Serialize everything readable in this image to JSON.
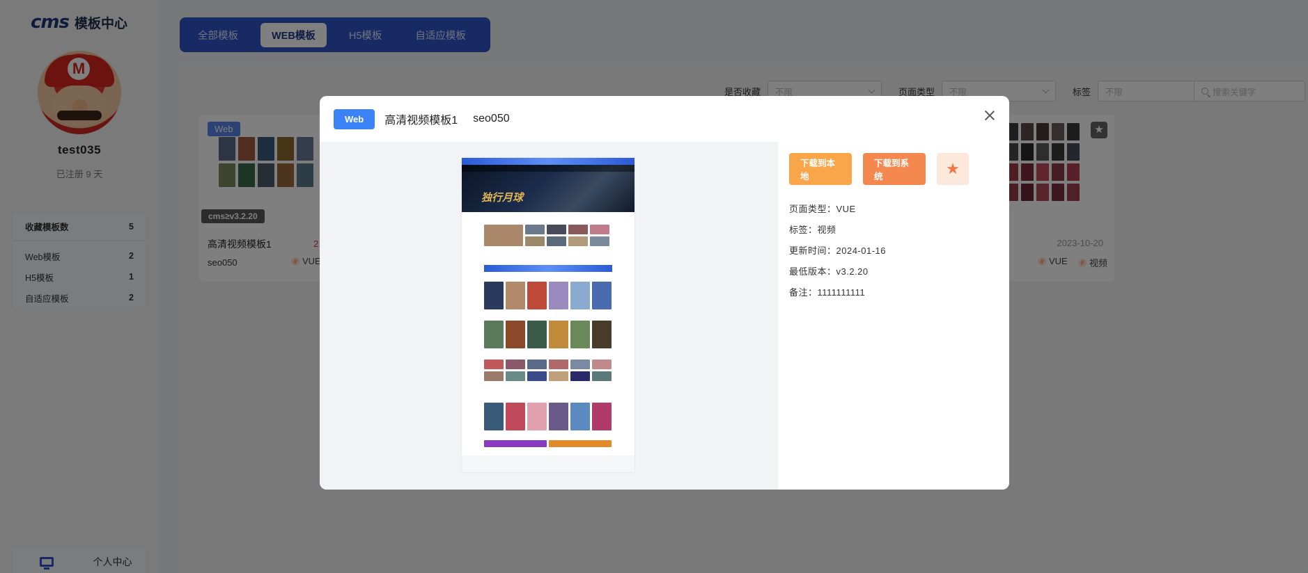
{
  "app": {
    "logo_mark": "cms",
    "logo_text": "模板中心"
  },
  "user": {
    "name": "test035",
    "registered": "已注册 9 天"
  },
  "stats": {
    "total_label": "收藏模板数",
    "total_value": "5",
    "items": [
      {
        "label": "Web模板",
        "value": "2"
      },
      {
        "label": "H5模板",
        "value": "1"
      },
      {
        "label": "自适应模板",
        "value": "2"
      }
    ]
  },
  "bottom_nav": {
    "icon": "monitor-icon",
    "label": "个人中心"
  },
  "tabs": [
    {
      "label": "全部模板",
      "active": false
    },
    {
      "label": "WEB模板",
      "active": true
    },
    {
      "label": "H5模板",
      "active": false
    },
    {
      "label": "自适应模板",
      "active": false
    }
  ],
  "filters": {
    "collected_label": "是否收藏",
    "collected_value": "不限",
    "page_type_label": "页面类型",
    "page_type_value": "不限",
    "tag_label": "标签",
    "tag_value": "不限",
    "search_placeholder": "搜索关键字"
  },
  "cards": {
    "left": {
      "badge": "Web",
      "version": "cms≥v3.2.20",
      "title": "高清视频模板1",
      "code": "seo050",
      "chip": "VUE",
      "date_fragment": "2"
    },
    "right": {
      "date": "2023-10-20",
      "chip1": "VUE",
      "chip2": "视频"
    }
  },
  "modal": {
    "tag": "Web",
    "title": "高清视频模板1",
    "code": "seo050",
    "preview": {
      "hero_text": "独行月球"
    },
    "buttons": {
      "download_local": "下载到本地",
      "download_system": "下载到系统",
      "favorite_icon": "star-icon"
    },
    "info": [
      "页面类型：VUE",
      "标签：视频",
      "更新时间：2024-01-16",
      "最低版本：v3.2.20",
      "备注：1111111111"
    ]
  },
  "colors": {
    "primary": "#2f55c9",
    "modal_tag": "#3b82f6",
    "btn_local": "#f9a54a",
    "btn_system": "#f5884e",
    "btn_fav_bg": "#fde8dc"
  }
}
